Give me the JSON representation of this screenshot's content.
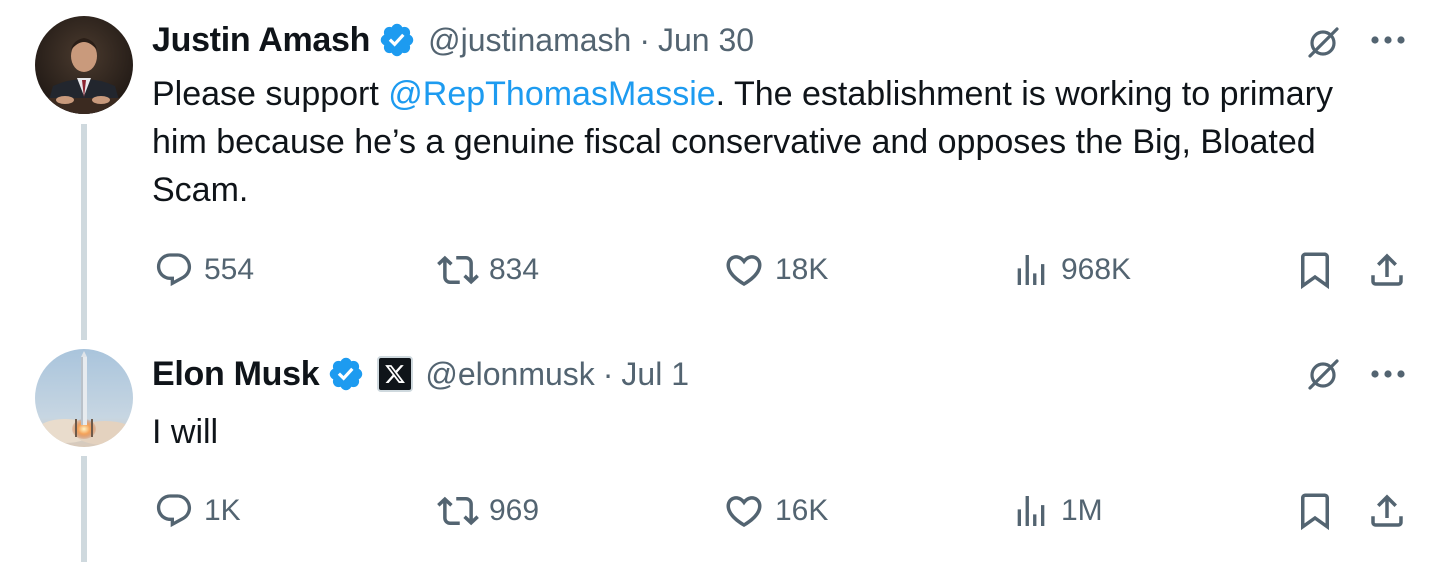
{
  "tweets": [
    {
      "author": {
        "name": "Justin Amash",
        "handle": "@justinamash",
        "verified": true
      },
      "separator": "·",
      "date": "Jun 30",
      "text_before": "Please support ",
      "mention": "@RepThomasMassie",
      "text_after": ". The establishment is working to primary him because he’s a genuine fiscal conservative and opposes the Big, Bloated Scam.",
      "stats": {
        "replies": "554",
        "reposts": "834",
        "likes": "18K",
        "views": "968K"
      }
    },
    {
      "author": {
        "name": "Elon Musk",
        "handle": "@elonmusk",
        "verified": true,
        "affiliate_badge": "X"
      },
      "separator": "·",
      "date": "Jul 1",
      "text": "I will",
      "stats": {
        "replies": "1K",
        "reposts": "969",
        "likes": "16K",
        "views": "1M"
      }
    }
  ],
  "icons": {
    "verified": "verified-badge-icon",
    "grok": "grok-icon",
    "more": "more-icon",
    "reply": "reply-icon",
    "repost": "repost-icon",
    "like": "like-icon",
    "views": "views-icon",
    "bookmark": "bookmark-icon",
    "share": "share-icon"
  },
  "colors": {
    "accent": "#1d9bf0",
    "text": "#0f1419",
    "secondary": "#536471",
    "thread_line": "#cfd9de"
  }
}
